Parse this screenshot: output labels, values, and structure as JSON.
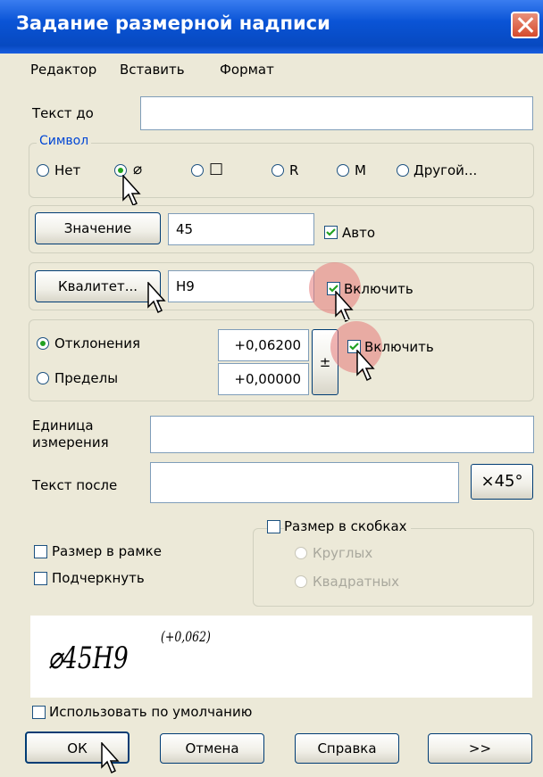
{
  "window": {
    "title": "Задание размерной надписи"
  },
  "menu": [
    "Редактор",
    "Вставить",
    "Формат"
  ],
  "text_before": {
    "label": "Текст до",
    "value": ""
  },
  "symbol_group": {
    "label": "Символ",
    "options": [
      "Нет",
      "⌀",
      "□",
      "R",
      "M",
      "Другой..."
    ],
    "selected": "⌀"
  },
  "value_row": {
    "button": "Значение",
    "value": "45",
    "auto_label": "Авто",
    "auto_checked": true
  },
  "quality_row": {
    "button": "Квалитет...",
    "value": "H9",
    "enable_label": "Включить",
    "enable_checked": true
  },
  "deviation_group": {
    "deviations_label": "Отклонения",
    "limits_label": "Пределы",
    "selected": "Отклонения",
    "upper": "+0,06200",
    "lower": "+0,00000",
    "plusminus": "±",
    "enable_label": "Включить",
    "enable_checked": true
  },
  "unit": {
    "label_line1": "Единица",
    "label_line2": "измерения",
    "value": ""
  },
  "text_after": {
    "label": "Текст после",
    "value": "",
    "button": "×45°"
  },
  "frame_checkbox": {
    "label": "Размер в рамке",
    "checked": false
  },
  "underline_checkbox": {
    "label": "Подчеркнуть",
    "checked": false
  },
  "brackets": {
    "label": "Размер в скобках",
    "checked": false,
    "round": "Круглых",
    "square": "Квадратных"
  },
  "preview": {
    "main": "⌀45H9",
    "sup": "(+0,062)"
  },
  "default_checkbox": {
    "label": "Использовать по умолчанию",
    "checked": false
  },
  "buttons": {
    "ok": "ОК",
    "cancel": "Отмена",
    "help": "Справка",
    "more": ">>"
  },
  "colors": {
    "title_bar": "#0a54d6",
    "face": "#ece9d8",
    "group_label": "#0046d5",
    "check": "#21a121",
    "highlight": "#e67878"
  }
}
